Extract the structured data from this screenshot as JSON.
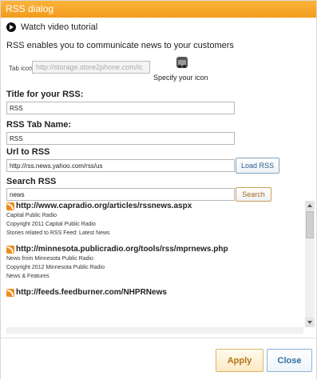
{
  "dialog": {
    "title": "RSS dialog",
    "tutorial_label": "Watch video tutorial",
    "intro": "RSS enables you to communicate news to your customers",
    "tab_icon": {
      "label": "Tab icon",
      "value": "http://storage.store2phone.com/ic",
      "specify_label": "Specify your icon"
    },
    "title_field": {
      "label": "Title for your RSS:",
      "value": "RSS"
    },
    "tab_name_field": {
      "label": "RSS Tab Name:",
      "value": "RSS"
    },
    "url_field": {
      "label": "Url to RSS",
      "value": "http://rss.news.yahoo.com/rss/us",
      "button": "Load RSS"
    },
    "search_field": {
      "label": "Search RSS",
      "value": "news",
      "button": "Search"
    },
    "results": [
      {
        "url": "http://www.capradio.org/articles/rssnews.aspx",
        "lines": [
          "Capital Public Radio",
          "Copyright 2011 Capital Public Radio",
          "Stories related to RSS Feed: Latest News"
        ]
      },
      {
        "url": "http://minnesota.publicradio.org/tools/rss/mprnews.php",
        "lines": [
          "News from Minnesota Public Radio",
          "Copyright 2012 Minnesota Public Radio",
          "News & Features"
        ]
      },
      {
        "url": "http://feeds.feedburner.com/NHPRNews",
        "lines": []
      }
    ],
    "apply": "Apply",
    "close": "Close"
  }
}
